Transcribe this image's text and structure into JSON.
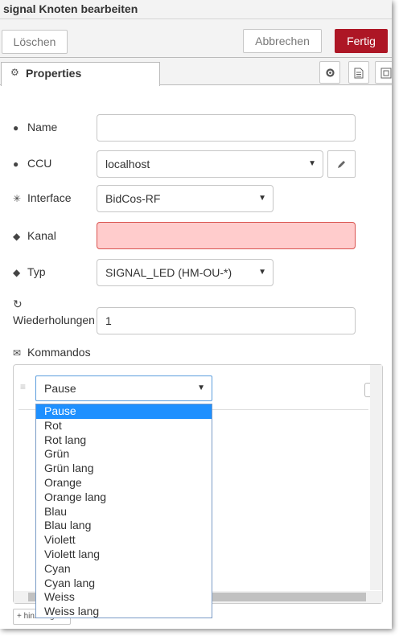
{
  "window": {
    "title": "signal Knoten bearbeiten"
  },
  "buttons": {
    "delete": "Löschen",
    "cancel": "Abbrechen",
    "done": "Fertig"
  },
  "tabs": [
    {
      "label": "Properties",
      "icon": "gear-icon"
    }
  ],
  "tab_buttons": [
    "gear-icon",
    "document-icon",
    "frame-icon"
  ],
  "form": {
    "name": {
      "label": "Name",
      "icon": "globe-icon",
      "value": ""
    },
    "ccu": {
      "label": "CCU",
      "icon": "globe-icon",
      "value": "localhost",
      "edit_icon": "pencil-icon"
    },
    "interface": {
      "label": "Interface",
      "icon": "asterisk-icon",
      "value": "BidCos-RF"
    },
    "kanal": {
      "label": "Kanal",
      "icon": "tags-icon",
      "value": ""
    },
    "typ": {
      "label": "Typ",
      "icon": "tags-icon",
      "value": "SIGNAL_LED (HM-OU-*)"
    },
    "wiederholungen": {
      "label": "Wiederholungen",
      "icon": "refresh-icon",
      "value": "1"
    },
    "kommandos": {
      "label": "Kommandos",
      "icon": "envelope-icon"
    }
  },
  "command_select": {
    "value": "Pause"
  },
  "dropdown": {
    "options": [
      "Pause",
      "Rot",
      "Rot lang",
      "Grün",
      "Grün lang",
      "Orange",
      "Orange lang",
      "Blau",
      "Blau lang",
      "Violett",
      "Violett lang",
      "Cyan",
      "Cyan lang",
      "Weiss",
      "Weiss lang"
    ],
    "selected": "Pause"
  },
  "add_button": {
    "label": "hinzufügen"
  }
}
